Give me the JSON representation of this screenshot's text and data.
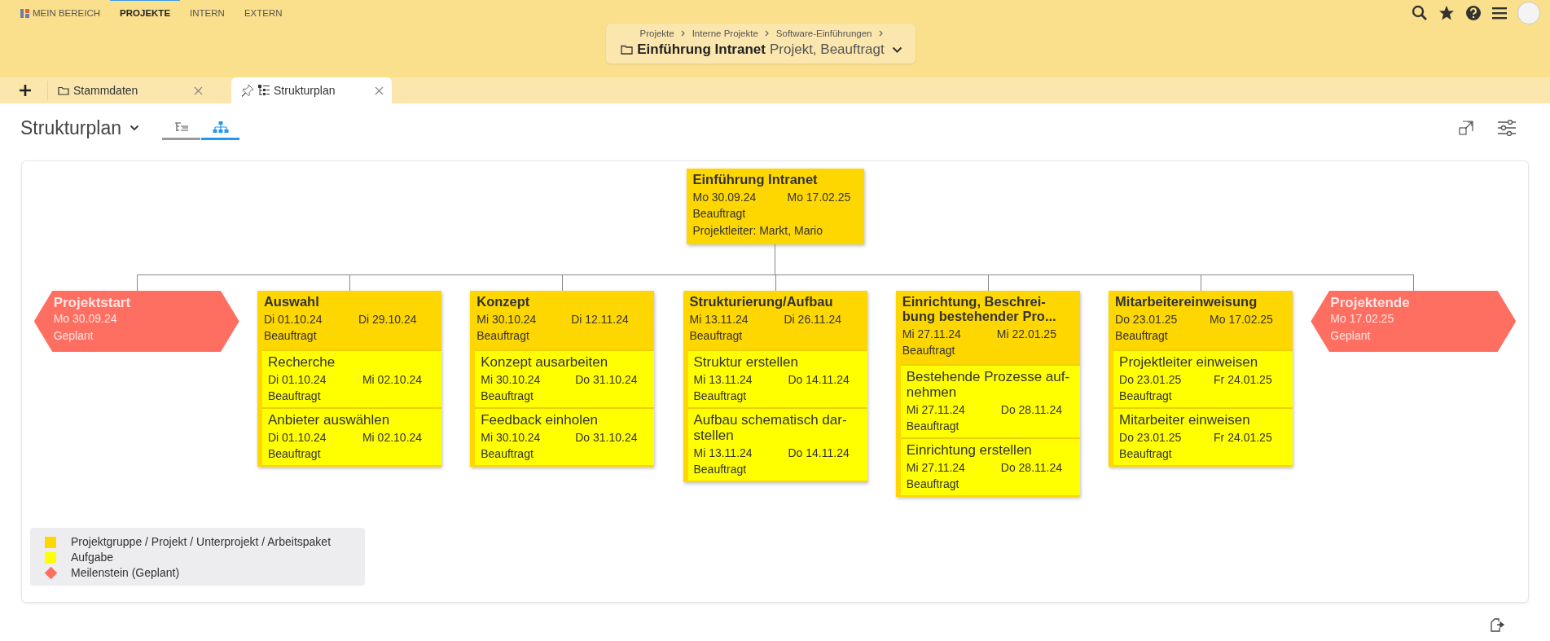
{
  "nav": [
    {
      "label": "MEIN BEREICH",
      "kind": "home",
      "selected": false
    },
    {
      "label": "PROJEKTE",
      "selected": true
    },
    {
      "label": "INTERN",
      "selected": false
    },
    {
      "label": "EXTERN",
      "selected": false
    }
  ],
  "breadcrumb": {
    "path": [
      "Projekte",
      "Interne Projekte",
      "Software-Einführungen"
    ],
    "title": "Einführung Intranet",
    "subtitle": "Projekt, Beauftragt"
  },
  "tabs": [
    {
      "label": "Stammdaten",
      "kind": "folder",
      "selected": false
    },
    {
      "label": "Strukturplan",
      "kind": "structure",
      "selected": true
    }
  ],
  "page_title": "Strukturplan",
  "views": [
    {
      "kind": "list",
      "selected": false
    },
    {
      "kind": "chart",
      "selected": true
    }
  ],
  "root": {
    "title": "Einführung Intranet",
    "start": "Mo 30.09.24",
    "end": "Mo 17.02.25",
    "status": "Beauftragt",
    "leader": "Projektleiter: Markt, Mario"
  },
  "nodes": [
    {
      "kind": "milestone",
      "title": "Projektstart",
      "date": "Mo 30.09.24",
      "status": "Geplant"
    },
    {
      "kind": "package",
      "title": "Auswahl",
      "start": "Di 01.10.24",
      "end": "Di 29.10.24",
      "status": "Beauftragt",
      "tasks": [
        {
          "title": "Recherche",
          "start": "Di 01.10.24",
          "end": "Mi 02.10.24",
          "status": "Beauftragt"
        },
        {
          "title": "Anbieter auswählen",
          "start": "Di 01.10.24",
          "end": "Mi 02.10.24",
          "status": "Beauftragt"
        }
      ]
    },
    {
      "kind": "package",
      "title": "Konzept",
      "start": "Mi 30.10.24",
      "end": "Di 12.11.24",
      "status": "Beauftragt",
      "tasks": [
        {
          "title": "Konzept ausarbeiten",
          "start": "Mi 30.10.24",
          "end": "Do 31.10.24",
          "status": "Beauftragt"
        },
        {
          "title": "Feedback einholen",
          "start": "Mi 30.10.24",
          "end": "Do 31.10.24",
          "status": "Beauftragt"
        }
      ]
    },
    {
      "kind": "package",
      "title": "Strukturierung/Aufbau",
      "start": "Mi 13.11.24",
      "end": "Di 26.11.24",
      "status": "Beauftragt",
      "tasks": [
        {
          "title": "Struktur erstellen",
          "start": "Mi 13.11.24",
          "end": "Do 14.11.24",
          "status": "Beauftragt"
        },
        {
          "title": "Aufbau schematisch dar-stellen",
          "start": "Mi 13.11.24",
          "end": "Do 14.11.24",
          "status": "Beauftragt"
        }
      ]
    },
    {
      "kind": "package",
      "title": "Einrichtung, Beschrei-bung bestehender Pro...",
      "start": "Mi 27.11.24",
      "end": "Mi 22.01.25",
      "status": "Beauftragt",
      "tasks": [
        {
          "title": "Bestehende Prozesse auf-nehmen",
          "start": "Mi 27.11.24",
          "end": "Do 28.11.24",
          "status": "Beauftragt"
        },
        {
          "title": "Einrichtung erstellen",
          "start": "Mi 27.11.24",
          "end": "Do 28.11.24",
          "status": "Beauftragt"
        }
      ]
    },
    {
      "kind": "package",
      "title": "Mitarbeitereinweisung",
      "start": "Do 23.01.25",
      "end": "Mo 17.02.25",
      "status": "Beauftragt",
      "tasks": [
        {
          "title": "Projektleiter einweisen",
          "start": "Do 23.01.25",
          "end": "Fr 24.01.25",
          "status": "Beauftragt"
        },
        {
          "title": "Mitarbeiter einweisen",
          "start": "Do 23.01.25",
          "end": "Fr 24.01.25",
          "status": "Beauftragt"
        }
      ]
    },
    {
      "kind": "milestone",
      "title": "Projektende",
      "date": "Mo 17.02.25",
      "status": "Geplant"
    }
  ],
  "legend": [
    {
      "kind": "square",
      "color": "#ffd700",
      "label": "Projektgruppe / Projekt / Unterprojekt / Arbeitspaket"
    },
    {
      "kind": "square",
      "color": "#ffff00",
      "label": "Aufgabe"
    },
    {
      "kind": "diamond",
      "color": "#ff6f61",
      "label": "Meilenstein (Geplant)"
    }
  ]
}
